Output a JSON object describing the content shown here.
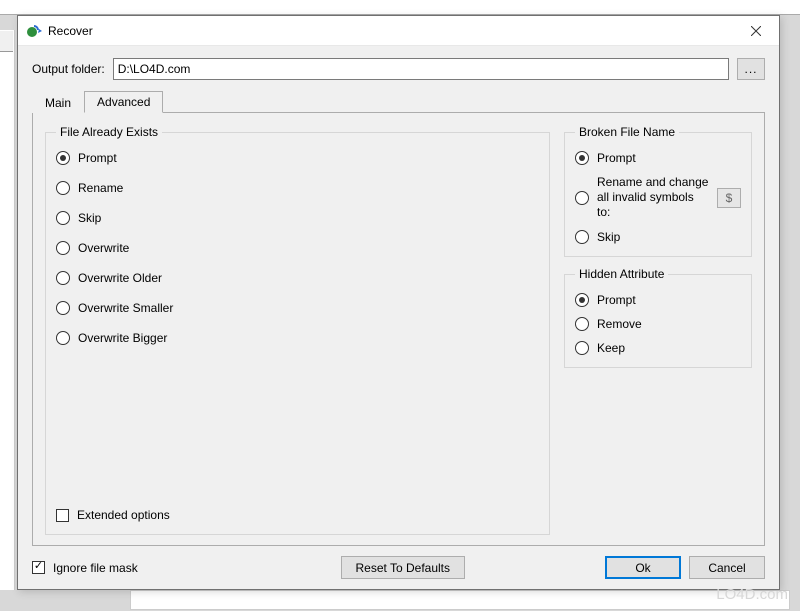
{
  "window": {
    "title": "Recover",
    "close_tooltip": "Close"
  },
  "output": {
    "label": "Output folder:",
    "value": "D:\\LO4D.com",
    "browse_label": "..."
  },
  "tabs": {
    "main": "Main",
    "advanced": "Advanced"
  },
  "fae": {
    "legend": "File Already Exists",
    "options": {
      "prompt": "Prompt",
      "rename": "Rename",
      "skip": "Skip",
      "overwrite": "Overwrite",
      "overwrite_older": "Overwrite Older",
      "overwrite_smaller": "Overwrite Smaller",
      "overwrite_bigger": "Overwrite Bigger"
    },
    "selected": "prompt",
    "extended_label": "Extended options",
    "extended_checked": false
  },
  "broken": {
    "legend": "Broken File Name",
    "options": {
      "prompt": "Prompt",
      "rename": "Rename and change all invalid symbols to:",
      "skip": "Skip"
    },
    "selected": "prompt",
    "symbol_value": "$"
  },
  "hidden": {
    "legend": "Hidden Attribute",
    "options": {
      "prompt": "Prompt",
      "remove": "Remove",
      "keep": "Keep"
    },
    "selected": "prompt"
  },
  "footer": {
    "ignore_mask_label": "Ignore file mask",
    "ignore_mask_checked": true,
    "reset_label": "Reset To Defaults",
    "ok_label": "Ok",
    "cancel_label": "Cancel"
  },
  "watermark": "LO4D.com"
}
